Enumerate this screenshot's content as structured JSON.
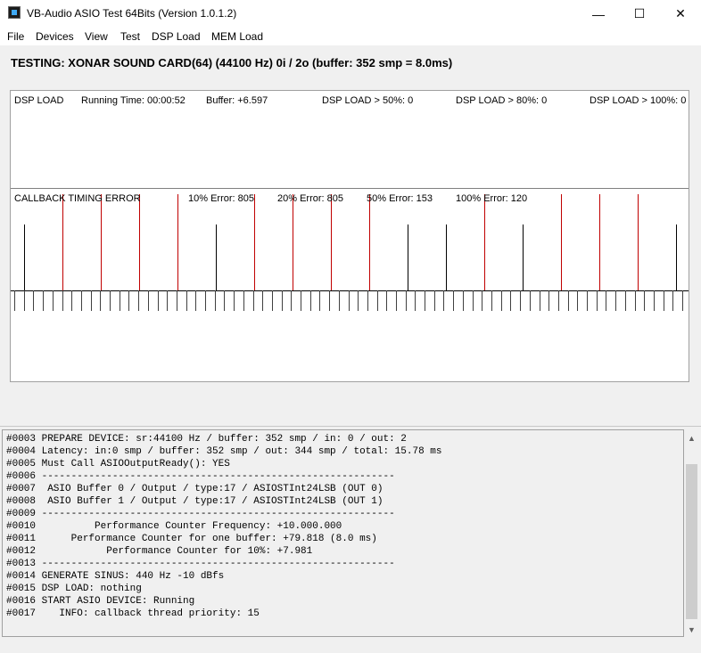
{
  "window": {
    "title": "VB-Audio ASIO Test 64Bits (Version 1.0.1.2)",
    "minimize_glyph": "—",
    "maximize_glyph": "☐",
    "close_glyph": "✕"
  },
  "menu": {
    "file": "File",
    "devices": "Devices",
    "view": "View",
    "test": "Test",
    "dsp_load": "DSP Load",
    "mem_load": "MEM Load"
  },
  "testing_header": "TESTING: XONAR SOUND CARD(64) (44100 Hz) 0i / 2o (buffer: 352 smp = 8.0ms)",
  "dsp_panel": {
    "title": "DSP LOAD",
    "running_time": "Running Time: 00:00:52",
    "buffer": "Buffer: +6.597",
    "over50": "DSP LOAD > 50%: 0",
    "over80": "DSP LOAD > 80%: 0",
    "over100": "DSP LOAD > 100%: 0"
  },
  "callback_panel": {
    "title": "CALLBACK TIMING ERROR",
    "err10": "10% Error: 805",
    "err20": "20% Error: 805",
    "err50": "50% Error: 153",
    "err100": "100% Error: 120",
    "red_color": "#c00000",
    "black_color": "#000000",
    "spikes": [
      {
        "c": "black"
      },
      {
        "c": "red"
      },
      {
        "c": "red"
      },
      {
        "c": "red"
      },
      {
        "c": "red"
      },
      {
        "c": "black"
      },
      {
        "c": "red"
      },
      {
        "c": "red"
      },
      {
        "c": "red"
      },
      {
        "c": "red"
      },
      {
        "c": "black"
      },
      {
        "c": "black"
      },
      {
        "c": "red"
      },
      {
        "c": "black"
      },
      {
        "c": "red"
      },
      {
        "c": "red"
      },
      {
        "c": "red"
      },
      {
        "c": "black"
      }
    ],
    "tick_count": 71
  },
  "log": {
    "lines": [
      "#0003 PREPARE DEVICE: sr:44100 Hz / buffer: 352 smp / in: 0 / out: 2",
      "#0004 Latency: in:0 smp / buffer: 352 smp / out: 344 smp / total: 15.78 ms",
      "#0005 Must Call ASIOOutputReady(): YES",
      "#0006 ------------------------------------------------------------",
      "#0007  ASIO Buffer 0 / Output / type:17 / ASIOSTInt24LSB (OUT 0)",
      "#0008  ASIO Buffer 1 / Output / type:17 / ASIOSTInt24LSB (OUT 1)",
      "#0009 ------------------------------------------------------------",
      "#0010          Performance Counter Frequency: +10.000.000",
      "#0011      Performance Counter for one buffer: +79.818 (8.0 ms)",
      "#0012            Performance Counter for 10%: +7.981",
      "#0013 ------------------------------------------------------------",
      "#0014 GENERATE SINUS: 440 Hz -10 dBfs",
      "#0015 DSP LOAD: nothing",
      "#0016 START ASIO DEVICE: Running",
      "#0017    INFO: callback thread priority: 15"
    ]
  },
  "scrollbar": {
    "up_glyph": "▲",
    "down_glyph": "▼"
  }
}
